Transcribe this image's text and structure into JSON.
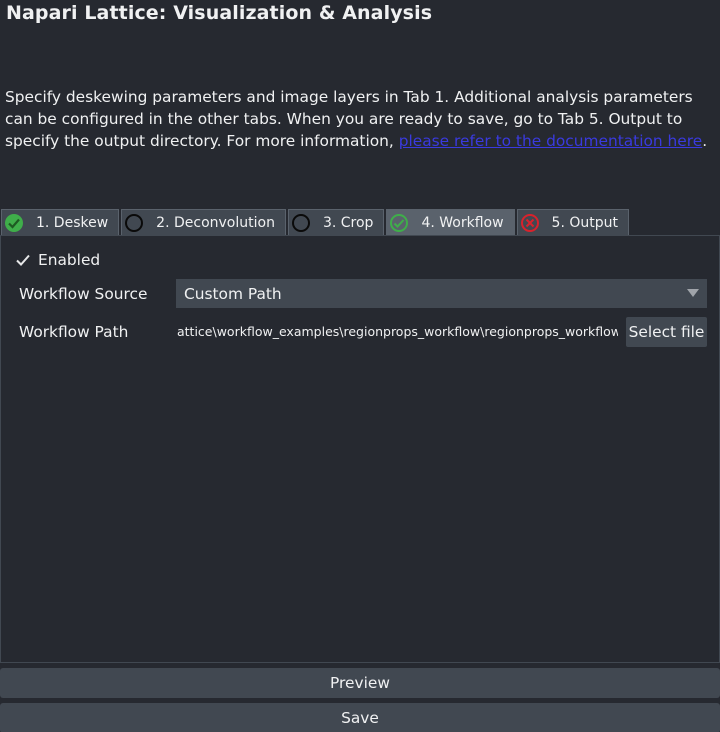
{
  "header": {
    "title": "Napari Lattice: Visualization & Analysis"
  },
  "description": {
    "text": "Specify deskewing parameters and image layers in Tab 1.  Additional analysis parameters can be configured in the other tabs.  When you are ready to save, go to Tab 5.  Output to specify the output directory.  For more information, ",
    "link_text": "please refer to the documentation here",
    "suffix": "."
  },
  "tabs": [
    {
      "label": "1. Deskew",
      "status": "ok"
    },
    {
      "label": "2. Deconvolution",
      "status": "none"
    },
    {
      "label": "3. Crop",
      "status": "none"
    },
    {
      "label": "4. Workflow",
      "status": "ok",
      "active": true
    },
    {
      "label": "5. Output",
      "status": "error"
    }
  ],
  "workflow": {
    "enabled_label": "Enabled",
    "enabled": true,
    "source_label": "Workflow Source",
    "source_value": "Custom Path",
    "path_label": "Workflow Path",
    "path_value": "attice\\workflow_examples\\regionprops_workflow\\regionprops_workflow.yml",
    "select_file_label": "Select file"
  },
  "footer": {
    "preview_label": "Preview",
    "save_label": "Save"
  },
  "colors": {
    "background": "#262930",
    "tab": "#414851",
    "tab_active": "#5a626c",
    "link": "#3a3adf",
    "ok": "#3fae4a",
    "error": "#d8222c"
  }
}
